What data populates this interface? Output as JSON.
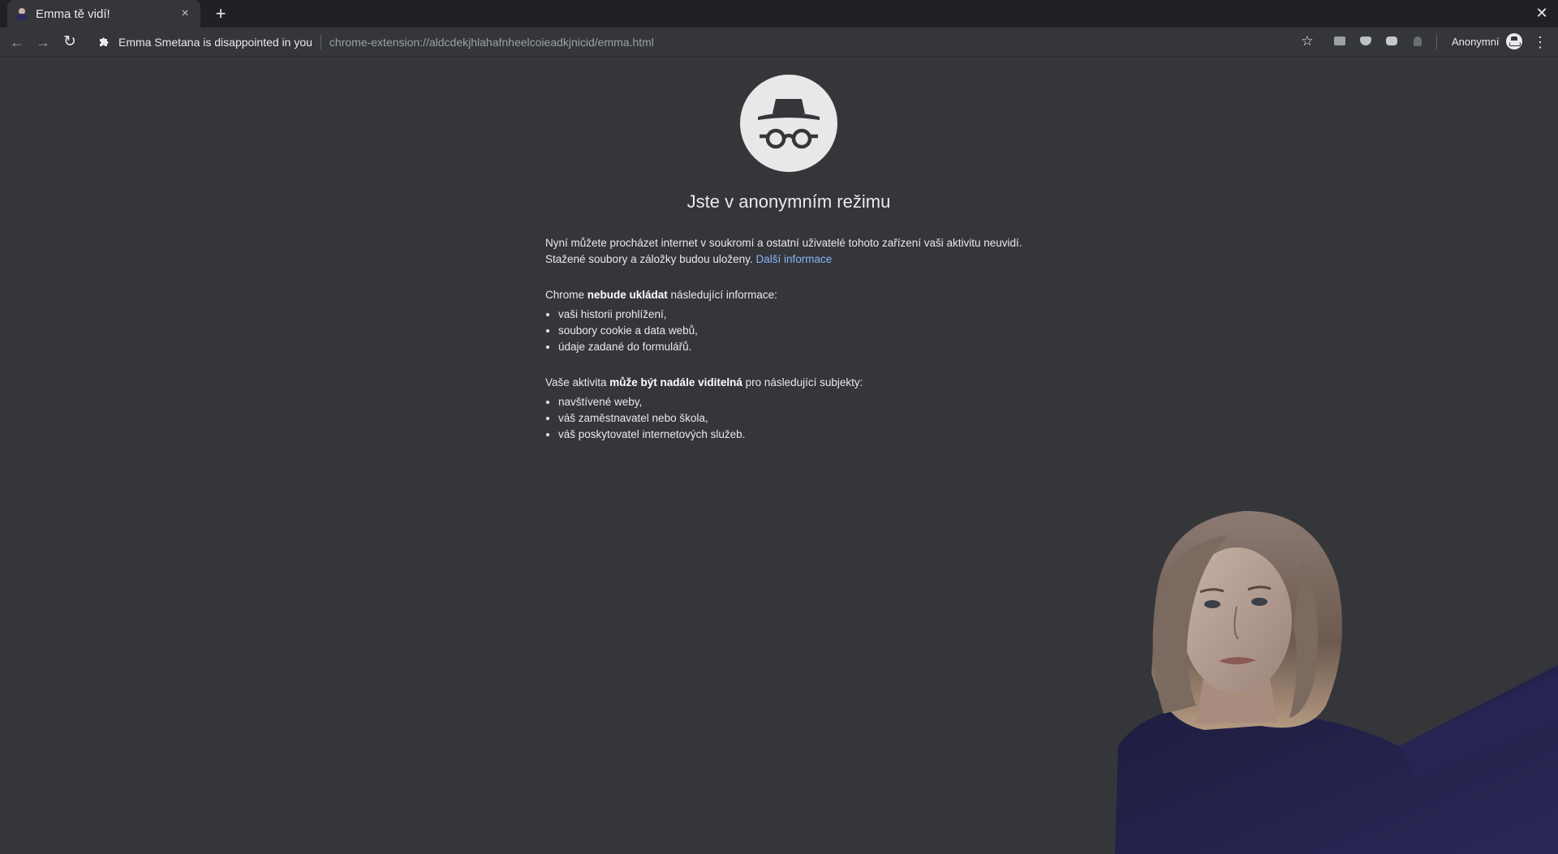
{
  "tab": {
    "title": "Emma tě vidí!",
    "close": "×",
    "new_tab": "+"
  },
  "window": {
    "close": "✕"
  },
  "toolbar": {
    "back": "←",
    "forward": "→",
    "reload": "↻",
    "origin": "Emma Smetana is disappointed in you",
    "url": "chrome-extension://aldcdekjhlahafnheelcoieadkjnicid/emma.html",
    "star": "☆",
    "profile_label": "Anonymní",
    "menu": "⋮"
  },
  "page": {
    "title": "Jste v anonymním režimu",
    "intro_text": "Nyní můžete procházet internet v soukromí a ostatní uživatelé tohoto zařízení vaši aktivitu neuvidí. Stažené soubory a záložky budou uloženy.",
    "intro_link": "Další informace",
    "block2_prefix": "Chrome ",
    "block2_strong": "nebude ukládat",
    "block2_suffix": " následující informace:",
    "block2_items": [
      "vaši historii prohlížení,",
      "soubory cookie a data webů,",
      "údaje zadané do formulářů."
    ],
    "block3_prefix": "Vaše aktivita ",
    "block3_strong": "může být nadále viditelná",
    "block3_suffix": " pro následující subjekty:",
    "block3_items": [
      "navštívené weby,",
      "váš zaměstnavatel nebo škola,",
      "váš poskytovatel internetových služeb."
    ]
  },
  "colors": {
    "background": "#35363a",
    "tabstrip": "#202124",
    "link": "#8ab4f8"
  },
  "icons": {
    "logo": "incognito-icon",
    "extension": "puzzle-icon"
  }
}
